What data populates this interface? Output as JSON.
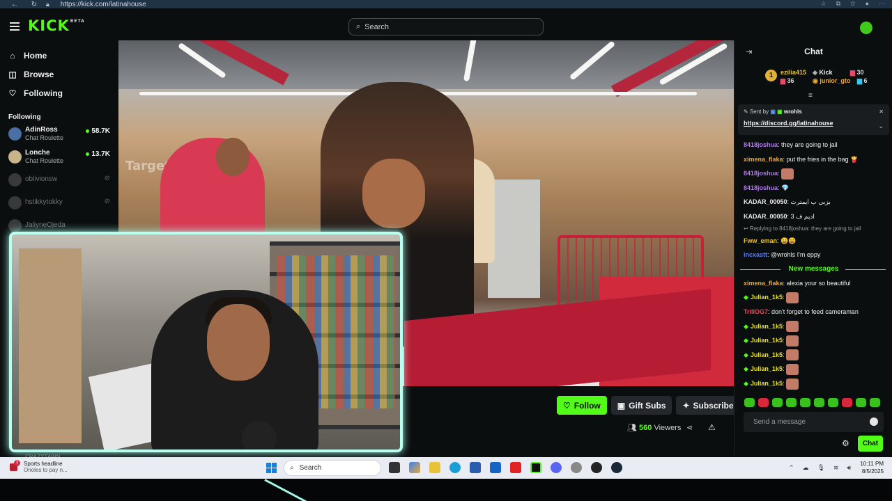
{
  "browser": {
    "url": "https://kick.com/latinahouse"
  },
  "header": {
    "logo_text": "KICK",
    "logo_badge": "BETA",
    "search_placeholder": "Search"
  },
  "sidebar": {
    "nav": [
      {
        "label": "Home",
        "icon": "home-icon"
      },
      {
        "label": "Browse",
        "icon": "compass-icon"
      },
      {
        "label": "Following",
        "icon": "heart-icon"
      }
    ],
    "following_header": "Following",
    "channels": [
      {
        "name": "AdinRoss",
        "category": "Chat Roulette",
        "viewers": "58.7K",
        "live": true,
        "color": "#4a6fa5"
      },
      {
        "name": "Lonche",
        "category": "Chat Roulette",
        "viewers": "13.7K",
        "live": true,
        "color": "#c8b48a"
      },
      {
        "name": "oblivionsw",
        "live": false
      },
      {
        "name": "hstikkytokky",
        "live": false
      },
      {
        "name": "JaliyneOjeda",
        "live": false
      }
    ]
  },
  "webcam": {
    "streamer_name": "CRAZYTAWN"
  },
  "actions": {
    "follow": "Follow",
    "gift_subs": "Gift Subs",
    "subscribe": "Subscribe",
    "viewers_count": "560",
    "viewers_label": "Viewers"
  },
  "chat": {
    "title": "Chat",
    "leaderboard": {
      "rank": "1",
      "first_name": "ezilia415",
      "first_count": "36",
      "second_name": "Kick",
      "second_count": "30",
      "third_name": "junior_gto",
      "third_count": "6"
    },
    "pinned": {
      "sent_by_label": "Sent by",
      "sender": "wrohls",
      "link": "https://discord.gg/latinahouse"
    },
    "messages_top": [
      {
        "user": "8418joshua",
        "color": "#b07bea",
        "text": "they are going to jail"
      },
      {
        "user": "ximena_flaka",
        "color": "#e8a735",
        "text": "put the fries in the bag 🍟"
      },
      {
        "user": "8418joshua",
        "color": "#b07bea",
        "text": "",
        "emote": true
      },
      {
        "user": "8418joshua",
        "color": "#b07bea",
        "text": "💎"
      },
      {
        "user": "KADAR_00050",
        "color": "#e6e6e6",
        "text": "بزبي ب ايمترت"
      },
      {
        "user": "KADAR_00050",
        "color": "#e6e6e6",
        "text": "ادپم ف 3"
      }
    ],
    "reply_text": "Replying to 8418joshua: they are going to jail",
    "messages_mid": [
      {
        "user": "Fww_eman",
        "color": "#e8c335",
        "text": "😄😄"
      },
      {
        "user": "incxastt",
        "color": "#5a7ce8",
        "text": "@wrohls I'm eppy"
      }
    ],
    "new_messages_label": "New messages",
    "messages_new": [
      {
        "user": "ximena_flaka",
        "color": "#e8a735",
        "text": "alexia your so beautiful"
      },
      {
        "user": "Julian_1k5",
        "color": "#e8e035",
        "text": "",
        "emote": true,
        "badge": true
      },
      {
        "user": "TrillOG7",
        "color": "#e84a5a",
        "text": "don't forget to feed cameraman"
      },
      {
        "user": "Julian_1k5",
        "color": "#e8e035",
        "text": "",
        "emote": true,
        "badge": true
      },
      {
        "user": "Julian_1k5",
        "color": "#e8e035",
        "text": "",
        "emote": true,
        "badge": true
      },
      {
        "user": "Julian_1k5",
        "color": "#e8e035",
        "text": "",
        "emote": true,
        "badge": true
      },
      {
        "user": "Julian_1k5",
        "color": "#e8e035",
        "text": "",
        "emote": true,
        "badge": true
      },
      {
        "user": "Julian_1k5",
        "color": "#e8e035",
        "text": "",
        "emote": true,
        "badge": true
      }
    ],
    "input_placeholder": "Send a message",
    "send_label": "Chat"
  },
  "taskbar": {
    "news_title": "Sports headline",
    "news_sub": "Orioles to pay n...",
    "news_badge": "3",
    "search_label": "Search",
    "time": "10:11 PM",
    "date": "8/5/2025"
  }
}
